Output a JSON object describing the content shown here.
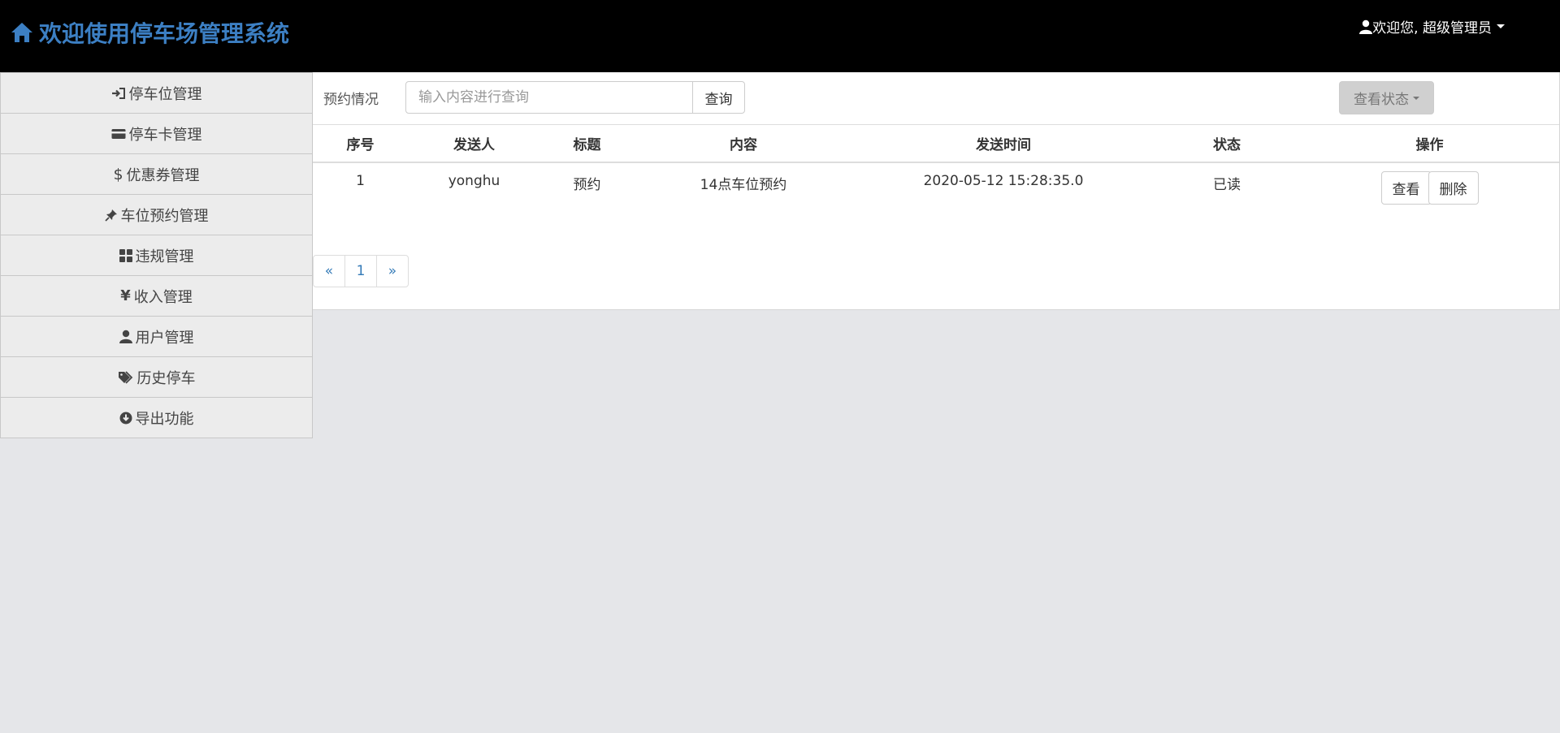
{
  "header": {
    "title": "欢迎使用停车场管理系统",
    "brand_icon": "home-icon",
    "user_label": "欢迎您, 超级管理员",
    "user_icon": "user-icon"
  },
  "sidebar": {
    "items": [
      {
        "label": "停车位管理",
        "icon": "sign-in-icon"
      },
      {
        "label": "停车卡管理",
        "icon": "credit-card-icon"
      },
      {
        "label": "优惠券管理",
        "icon": "dollar-icon"
      },
      {
        "label": "车位预约管理",
        "icon": "pushpin-icon"
      },
      {
        "label": "违规管理",
        "icon": "th-large-icon"
      },
      {
        "label": "收入管理",
        "icon": "yen-icon"
      },
      {
        "label": "用户管理",
        "icon": "user-icon"
      },
      {
        "label": "历史停车",
        "icon": "tags-icon"
      },
      {
        "label": "导出功能",
        "icon": "download-icon"
      }
    ]
  },
  "toolbar": {
    "label": "预约情况",
    "search_placeholder": "输入内容进行查询",
    "query_button": "查询",
    "status_button": "查看状态"
  },
  "table": {
    "headers": [
      "序号",
      "发送人",
      "标题",
      "内容",
      "发送时间",
      "状态",
      "操作"
    ],
    "rows": [
      {
        "index": "1",
        "sender": "yonghu",
        "title": "预约",
        "content": "14点车位预约",
        "time": "2020-05-12 15:28:35.0",
        "status": "已读",
        "view": "查看",
        "delete": "删除"
      }
    ]
  },
  "pagination": {
    "prev": "«",
    "page": "1",
    "next": "»"
  },
  "colors": {
    "brand": "#3c7fc3",
    "header_bg": "#000000",
    "link": "#337ab7"
  }
}
